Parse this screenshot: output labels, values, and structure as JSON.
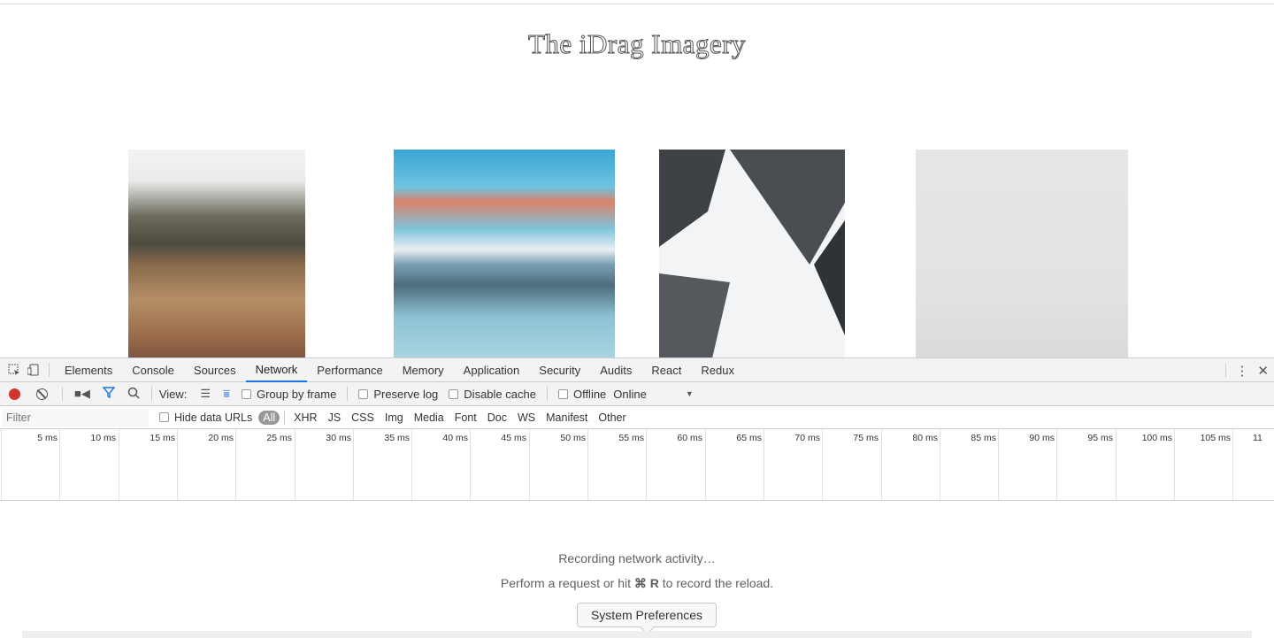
{
  "page": {
    "title": "The iDrag Imagery"
  },
  "devtools": {
    "tabs": [
      "Elements",
      "Console",
      "Sources",
      "Network",
      "Performance",
      "Memory",
      "Application",
      "Security",
      "Audits",
      "React",
      "Redux"
    ],
    "toolbar": {
      "view_label": "View:",
      "group_by_frame": "Group by frame",
      "preserve_log": "Preserve log",
      "disable_cache": "Disable cache",
      "offline": "Offline",
      "throttle": "Online"
    },
    "filter": {
      "placeholder": "Filter",
      "hide_data_urls": "Hide data URLs",
      "types": [
        "All",
        "XHR",
        "JS",
        "CSS",
        "Img",
        "Media",
        "Font",
        "Doc",
        "WS",
        "Manifest",
        "Other"
      ]
    },
    "timeline_ticks": [
      "5 ms",
      "10 ms",
      "15 ms",
      "20 ms",
      "25 ms",
      "30 ms",
      "35 ms",
      "40 ms",
      "45 ms",
      "50 ms",
      "55 ms",
      "60 ms",
      "65 ms",
      "70 ms",
      "75 ms",
      "80 ms",
      "85 ms",
      "90 ms",
      "95 ms",
      "100 ms",
      "105 ms",
      "11"
    ],
    "empty": {
      "line1": "Recording network activity…",
      "line2_pre": "Perform a request or hit ",
      "line2_keys": "⌘ R",
      "line2_post": " to record the reload."
    }
  },
  "tooltip": {
    "label": "System Preferences"
  }
}
